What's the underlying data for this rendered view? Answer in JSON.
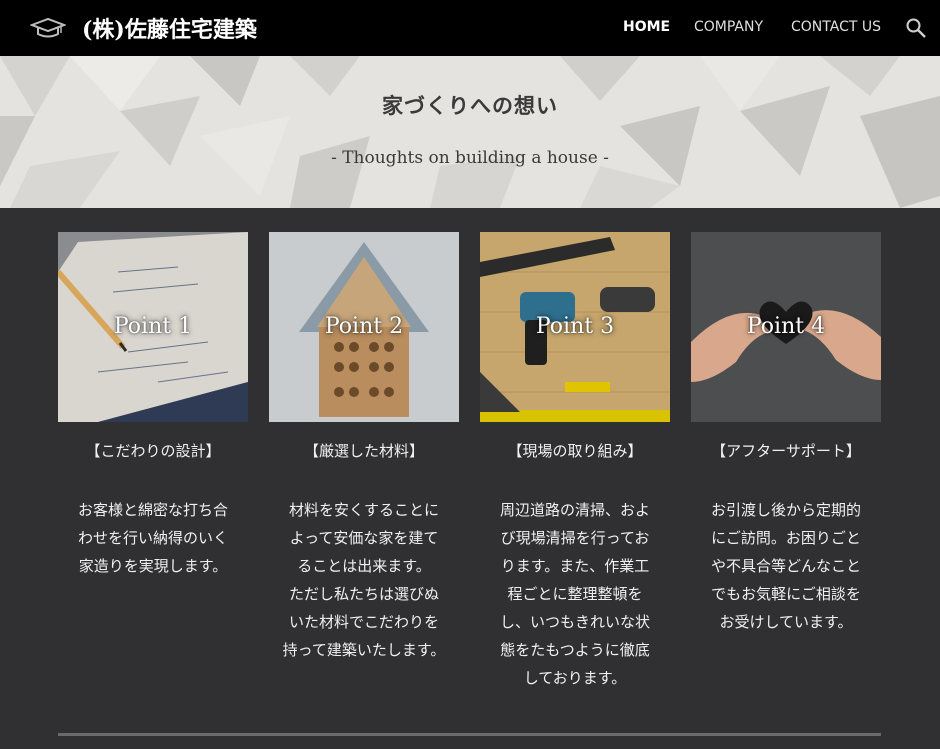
{
  "header": {
    "site_title": "(株)佐藤住宅建築",
    "nav": [
      {
        "label": "HOME",
        "active": true
      },
      {
        "label": "COMPANY",
        "active": false
      },
      {
        "label": "CONTACT US",
        "active": false
      }
    ]
  },
  "hero": {
    "title": "家づくりへの想い",
    "subtitle": "- Thoughts on building a house -"
  },
  "cards": [
    {
      "point": "Point 1",
      "heading": "【こだわりの設計】",
      "body": [
        "お客様と綿密な打ち合",
        "わせを行い納得のいく",
        "家造りを実現します。"
      ]
    },
    {
      "point": "Point 2",
      "heading": "【厳選した材料】",
      "body": [
        "材料を安くすることに",
        "よって安価な家を建て",
        "ることは出来ます。",
        "ただし私たちは選びぬ",
        "いた材料でこだわりを",
        "持って建築いたします。"
      ]
    },
    {
      "point": "Point 3",
      "heading": "【現場の取り組み】",
      "body": [
        "周辺道路の清掃、およ",
        "び現場清掃を行ってお",
        "ります。また、作業工",
        "程ごとに整理整頓を",
        "し、いつもきれいな状",
        "態をたもつように徹底",
        "しております。"
      ]
    },
    {
      "point": "Point 4",
      "heading": "【アフターサポート】",
      "body": [
        "お引渡し後から定期的",
        "にご訪問。お困りごと",
        "や不具合等どんなこと",
        "でもお気軽にご相談を",
        "お受けしています。"
      ]
    }
  ],
  "icons": {
    "logo": "graduation-cap-icon",
    "search": "search-icon"
  }
}
